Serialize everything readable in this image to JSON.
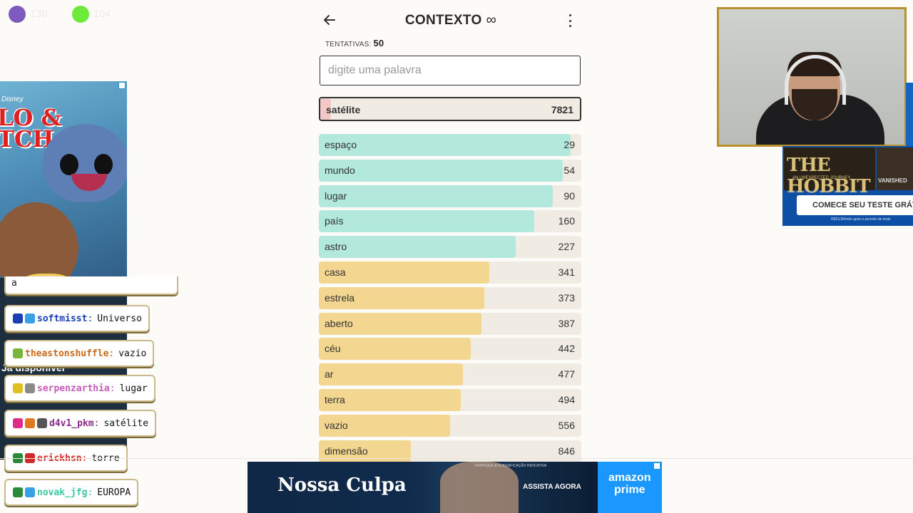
{
  "stream": {
    "viewers_a": "130",
    "viewers_b": "104",
    "colors": {
      "a": "#6a3fb5",
      "b": "#55e61a"
    }
  },
  "game": {
    "title": "CONTEXTO",
    "infinity_symbol": "∞",
    "icons": {
      "back": "arrow-left-icon",
      "menu": "more-vertical-icon"
    },
    "attempts_label": "TENTATIVAS:",
    "attempts_value": "50",
    "search_placeholder": "digite uma palavra",
    "current": {
      "word": "satélite",
      "rank": "7821",
      "color": "#f4c8c6"
    },
    "colors": {
      "close": "#b3e9dc",
      "medium": "#f3d690",
      "far": "#f4c8c6",
      "track": "#f0ece4"
    },
    "guesses": [
      {
        "word": "espaço",
        "rank": "29",
        "level": "close",
        "fill": 0.96
      },
      {
        "word": "mundo",
        "rank": "54",
        "level": "close",
        "fill": 0.93
      },
      {
        "word": "lugar",
        "rank": "90",
        "level": "close",
        "fill": 0.89
      },
      {
        "word": "país",
        "rank": "160",
        "level": "close",
        "fill": 0.82
      },
      {
        "word": "astro",
        "rank": "227",
        "level": "close",
        "fill": 0.75
      },
      {
        "word": "casa",
        "rank": "341",
        "level": "medium",
        "fill": 0.65
      },
      {
        "word": "estrela",
        "rank": "373",
        "level": "medium",
        "fill": 0.63
      },
      {
        "word": "aberto",
        "rank": "387",
        "level": "medium",
        "fill": 0.62
      },
      {
        "word": "céu",
        "rank": "442",
        "level": "medium",
        "fill": 0.58
      },
      {
        "word": "ar",
        "rank": "477",
        "level": "medium",
        "fill": 0.55
      },
      {
        "word": "terra",
        "rank": "494",
        "level": "medium",
        "fill": 0.54
      },
      {
        "word": "vazio",
        "rank": "556",
        "level": "medium",
        "fill": 0.5
      },
      {
        "word": "dimensão",
        "rank": "846",
        "level": "medium",
        "fill": 0.35
      }
    ]
  },
  "left_ad": {
    "brand": "Disney",
    "logo": "LO &\nTCH",
    "strip_text": "Já disponível"
  },
  "chat": {
    "partial_text": "a",
    "messages": [
      {
        "user": "softmisst",
        "text": "Universo",
        "color": "#1a3fb5",
        "badges": [
          "#1a3fb5",
          "#3aa0e6"
        ]
      },
      {
        "user": "theastonshuffle",
        "text": "vazio",
        "color": "#c86a1a",
        "badges": [
          "#7ab63a"
        ]
      },
      {
        "user": "serpenzarthia",
        "text": "lugar",
        "color": "#c85ab8",
        "badges": [
          "#e0c020",
          "#8a8a8a"
        ]
      },
      {
        "user": "d4v1_pkm",
        "text": "satélite",
        "color": "#8a2a8a",
        "badges": [
          "#e02a8a",
          "#e07a20",
          "#555555"
        ]
      },
      {
        "user": "erickhsn",
        "text": "torre",
        "color": "#d02a2a",
        "badges": [
          "#2a8a3a",
          "#d02a2a"
        ]
      },
      {
        "user": "novak_jfg",
        "text": "EUROPA",
        "color": "#3ac8a0",
        "badges": [
          "#2a8a3a",
          "#3aa0e6"
        ]
      }
    ]
  },
  "right_ad": {
    "poster_title": "THE HOBBIT",
    "poster_sub": "AN UNEXPECTED JOURNEY",
    "poster2": "VANISHED",
    "cta": "COMECE SEU TESTE GRÁT",
    "note": "R$19,90/mês após o período de teste"
  },
  "bottom_ad": {
    "title": "Nossa Culpa",
    "classification": "VERIFIQUE A CLASSIFICAÇÃO INDICATIVA",
    "cta": "ASSISTA AGORA",
    "brand": "amazon\nprime"
  }
}
